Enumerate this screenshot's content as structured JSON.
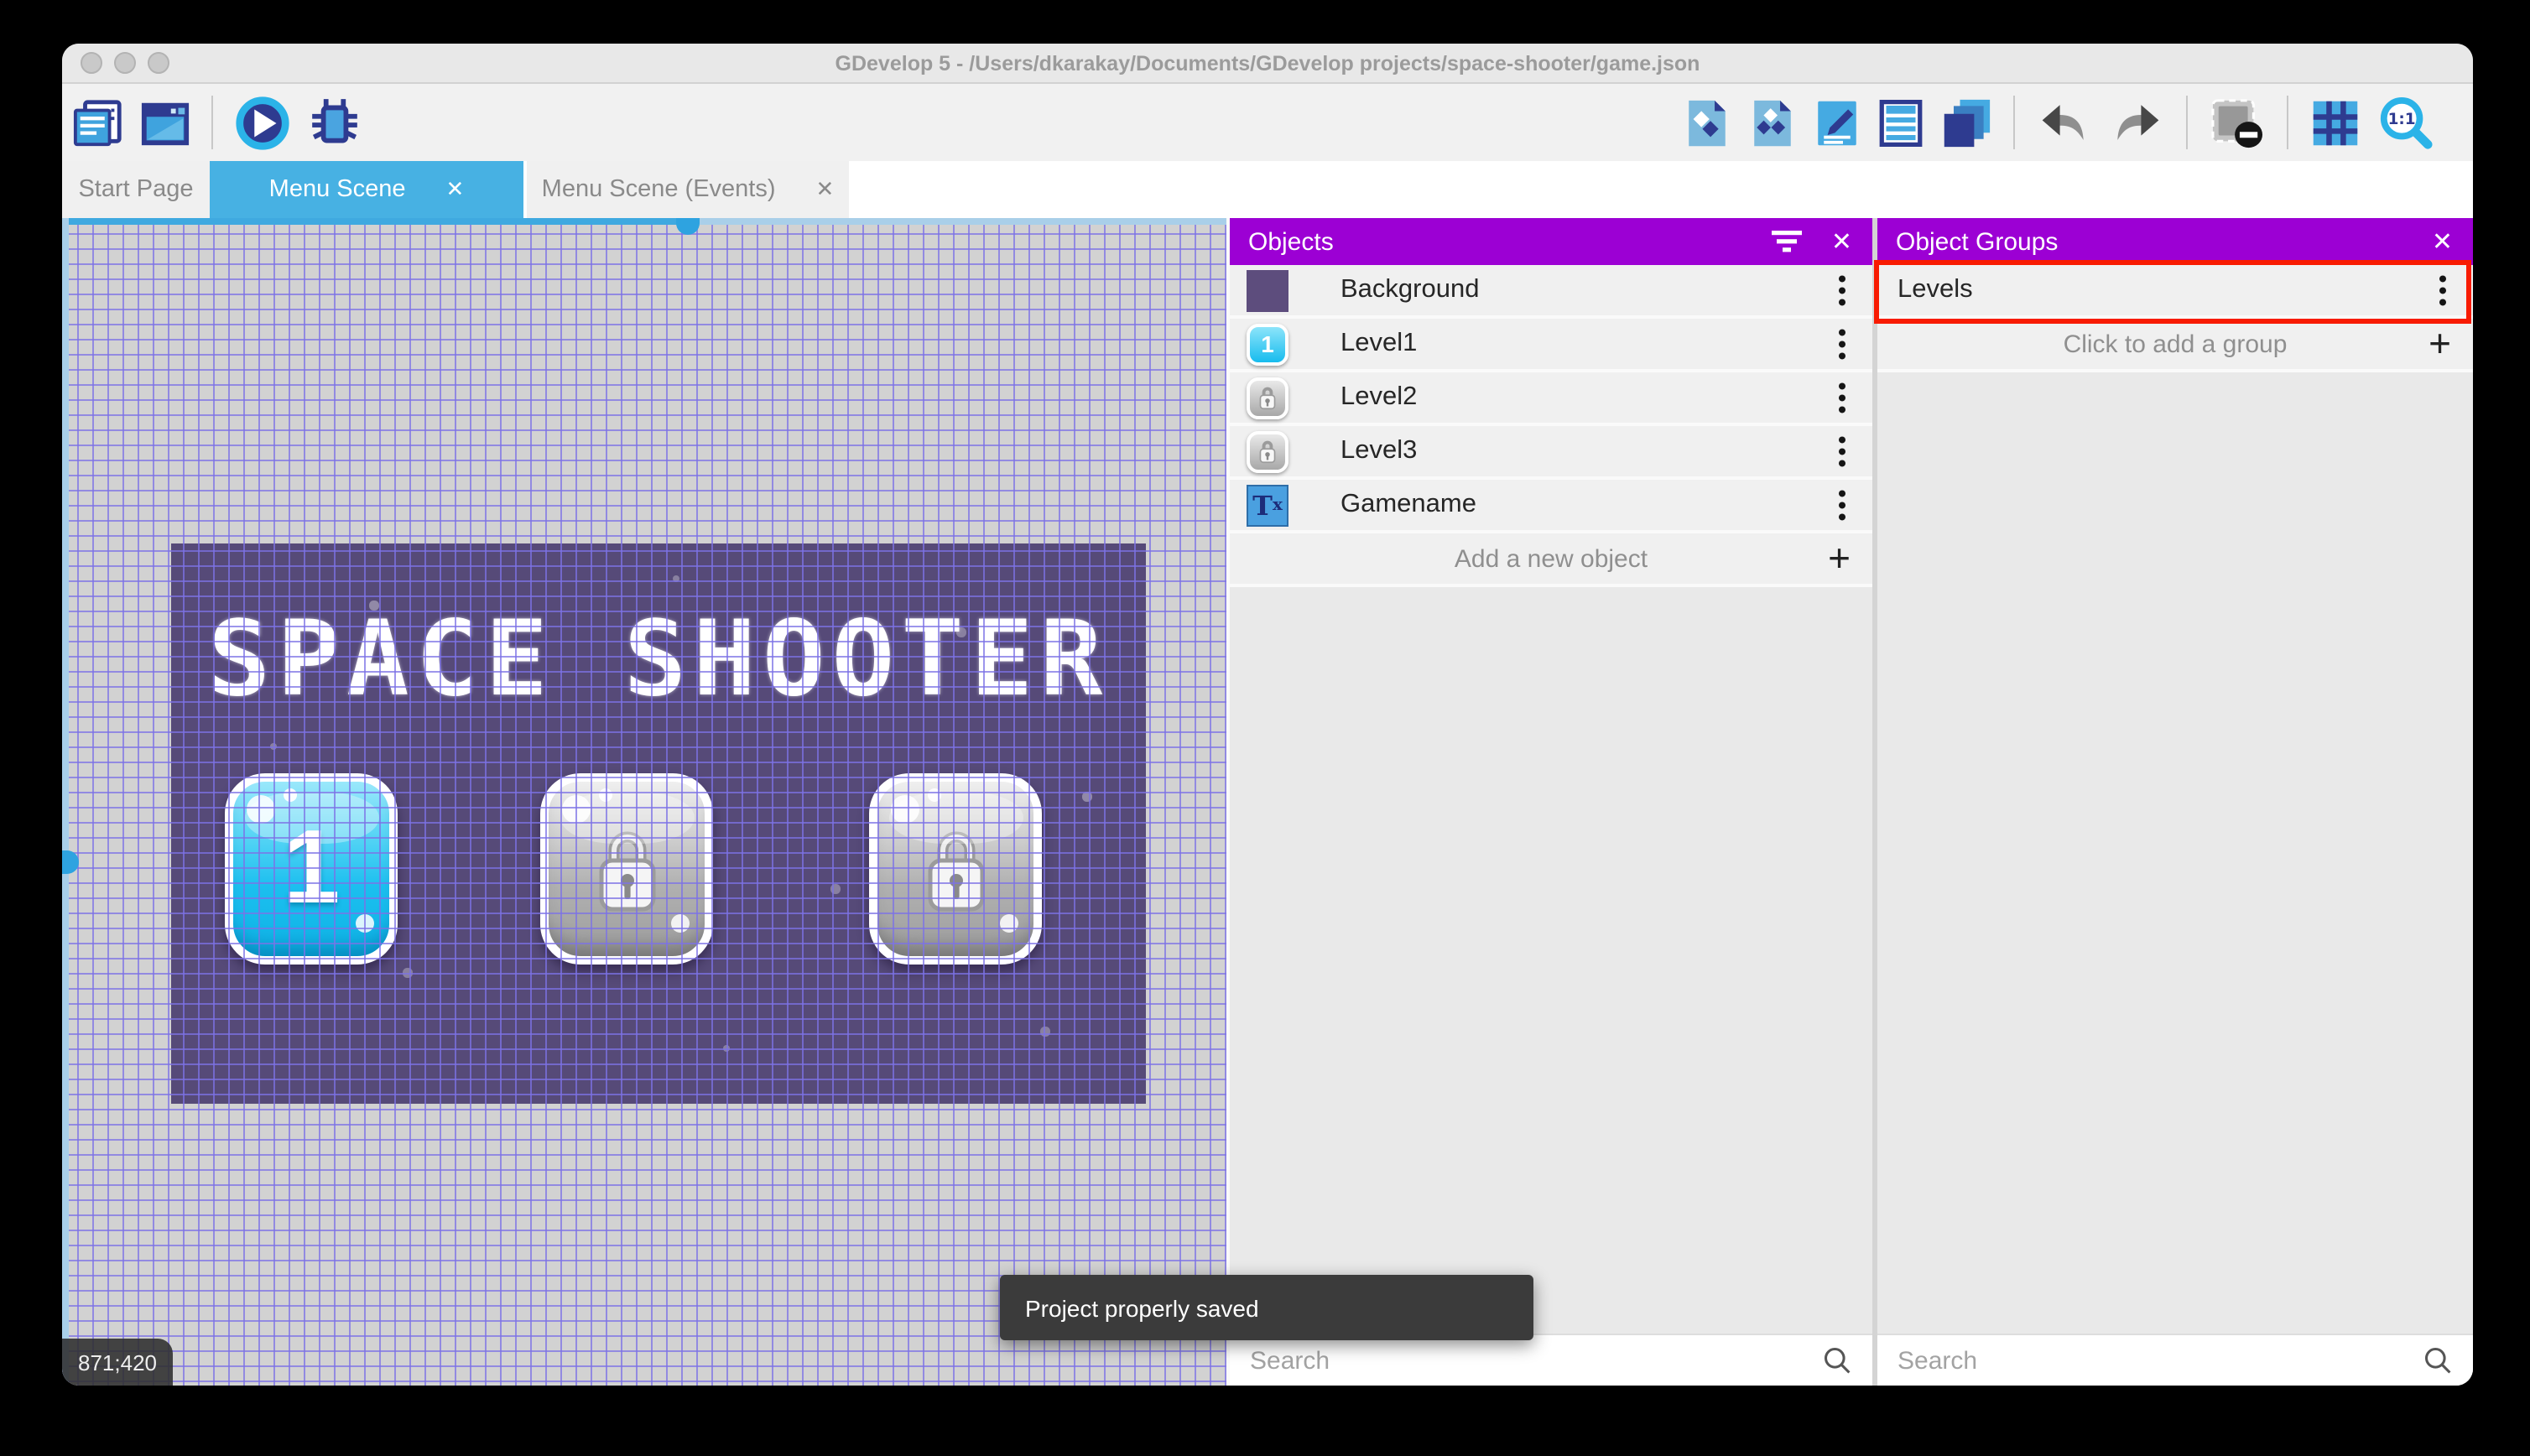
{
  "window": {
    "title": "GDevelop 5 - /Users/dkarakay/Documents/GDevelop projects/space-shooter/game.json"
  },
  "toolbar": {
    "left_icons": [
      "project-manager",
      "start-page",
      "play-preview",
      "debug"
    ],
    "right_icons": [
      "objects-editor",
      "object-groups-editor",
      "properties",
      "instances-list",
      "layers",
      "undo",
      "redo",
      "mask-preview",
      "grid",
      "zoom-1-1"
    ]
  },
  "tabs": [
    {
      "label": "Start Page",
      "active": false,
      "closable": false
    },
    {
      "label": "Menu Scene",
      "active": true,
      "closable": true
    },
    {
      "label": "Menu Scene (Events)",
      "active": false,
      "closable": true
    }
  ],
  "scene": {
    "title_text": "SPACE SHOOTER",
    "coordinates": "871;420",
    "buttons": [
      {
        "label": "1",
        "state": "unlocked"
      },
      {
        "label": "",
        "state": "locked"
      },
      {
        "label": "",
        "state": "locked"
      }
    ]
  },
  "objects_panel": {
    "title": "Objects",
    "items": [
      {
        "label": "Background",
        "thumb": "background"
      },
      {
        "label": "Level1",
        "thumb": "level1"
      },
      {
        "label": "Level2",
        "thumb": "lock"
      },
      {
        "label": "Level3",
        "thumb": "lock"
      },
      {
        "label": "Gamename",
        "thumb": "text"
      }
    ],
    "add_label": "Add a new object",
    "search_placeholder": "Search"
  },
  "object_groups_panel": {
    "title": "Object Groups",
    "groups": [
      {
        "label": "Levels",
        "highlighted": true
      }
    ],
    "add_label": "Click to add a group",
    "search_placeholder": "Search"
  },
  "toast": {
    "message": "Project properly saved"
  },
  "colors": {
    "accent_purple": "#9c00d4",
    "tab_blue": "#47b1e3",
    "highlight_red": "#f81b02",
    "scene_background": "#564a78",
    "grid_line": "#7c72e6"
  }
}
